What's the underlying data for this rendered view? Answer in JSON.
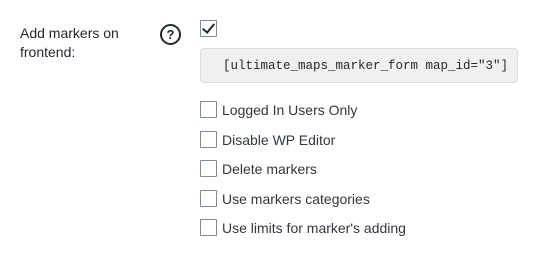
{
  "setting": {
    "label": "Add markers on frontend:",
    "help_symbol": "?",
    "enabled": true
  },
  "shortcode": "[ultimate_maps_marker_form map_id=\"3\"]",
  "options": [
    {
      "label": "Logged In Users Only",
      "checked": false
    },
    {
      "label": "Disable WP Editor",
      "checked": false
    },
    {
      "label": "Delete markers",
      "checked": false
    },
    {
      "label": "Use markers categories",
      "checked": false
    },
    {
      "label": "Use limits for marker's adding",
      "checked": false
    }
  ]
}
